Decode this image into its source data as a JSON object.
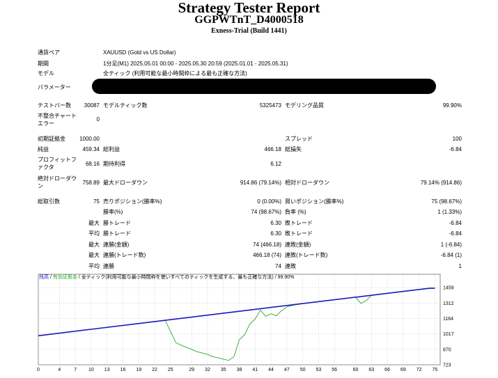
{
  "header": {
    "title": "Strategy Tester Report",
    "expert": "GGPWTnT_D4000518",
    "server": "Exness-Trial (Build 1441)"
  },
  "settings": {
    "symbol_label": "通貨ペア",
    "symbol_value": "XAUUSD (Gold vs US Dollar)",
    "period_label": "期間",
    "period_value": "1分足(M1) 2025.05.01 00:00 - 2025.05.30 20:59 (2025.01.01 - 2025.05.31)",
    "model_label": "モデル",
    "model_value": "全ティック (利用可能な最小時間枠による最も正確な方法)",
    "params_label": "パラメーター"
  },
  "stats": {
    "bars_label": "テストバー数",
    "bars_value": "30087",
    "ticks_label": "モデルティック数",
    "ticks_value": "5325473",
    "quality_label": "モデリング品質",
    "quality_value": "99.90%",
    "mismatch_label_1": "不整合チャート",
    "mismatch_label_2": "エラー",
    "mismatch_value": "0",
    "deposit_label": "初期証拠金",
    "deposit_value": "1000.00",
    "spread_label": "スプレッド",
    "spread_value": "100",
    "net_label": "純益",
    "net_value": "459.34",
    "gross_profit_label": "総利益",
    "gross_profit_value": "466.18",
    "gross_loss_label": "総損失",
    "gross_loss_value": "-6.84",
    "pf_label_1": "プロフィットフ",
    "pf_label_2": "ァクタ",
    "pf_value": "68.16",
    "expected_label": "期待利得",
    "expected_value": "6.12",
    "abs_dd_label_1": "絶対ドローダウ",
    "abs_dd_label_2": "ン",
    "abs_dd_value": "758.89",
    "max_dd_label": "最大ドローダウン",
    "max_dd_value": "914.86 (79.14%)",
    "rel_dd_label": "相対ドローダウン",
    "rel_dd_value": "79.14% (914.86)",
    "trades_label": "総取引数",
    "trades_value": "75",
    "short_label": "売りポジション(勝率%)",
    "short_value": "0 (0.00%)",
    "long_label": "買いポジション(勝率%)",
    "long_value": "75 (98.67%)",
    "win_pct_label": "勝率(%)",
    "win_pct_value": "74 (98.67%)",
    "loss_pct_label": "負率 (%)",
    "loss_pct_value": "1 (1.33%)",
    "max_word": "最大",
    "avg_word": "平均",
    "max_win_label": "勝トレード",
    "max_win_value": "6.30",
    "max_loss_label": "敗トレード",
    "max_loss_value": "-6.84",
    "avg_win_label": "勝トレード",
    "avg_win_value": "6.30",
    "avg_loss_label": "敗トレード",
    "avg_loss_value": "-6.84",
    "cons_win_money_label": "連勝(金額)",
    "cons_win_money_value": "74 (466.18)",
    "cons_loss_money_label": "連敗(金額)",
    "cons_loss_money_value": "1 (-6.84)",
    "cons_win_count_label": "連勝(トレード数)",
    "cons_win_count_value": "466.18 (74)",
    "cons_loss_count_label": "連敗(トレード数)",
    "cons_loss_count_value": "-6.84 (1)",
    "avg_cons_win_label": "連勝",
    "avg_cons_win_value": "74",
    "avg_cons_loss_label": "連敗",
    "avg_cons_loss_value": "1"
  },
  "chart_legend": {
    "balance": "残高",
    "equity": "有効証拠金",
    "description": "全ティック(利用可能な最小時間枠を使いすべてのティックを生成する、最も正確な方法)",
    "quality": "99.90%"
  },
  "chart_data": {
    "type": "line",
    "xlim": [
      0,
      76
    ],
    "ylim": [
      723,
      1520
    ],
    "x_ticks": [
      "0",
      "4",
      "7",
      "10",
      "13",
      "16",
      "19",
      "22",
      "25",
      "29",
      "32",
      "35",
      "38",
      "41",
      "44",
      "47",
      "50",
      "53",
      "56",
      "60",
      "63",
      "66",
      "69",
      "72",
      "75"
    ],
    "y_ticks": [
      "1459",
      "1312",
      "1164",
      "1017",
      "870",
      "723"
    ],
    "grid": true,
    "series": [
      {
        "color": "#1a1ab8",
        "x": [
          0,
          10,
          20,
          30,
          40,
          50,
          60,
          70,
          74,
          75
        ],
        "y": [
          1000,
          1062,
          1123,
          1184,
          1246,
          1307,
          1368,
          1429,
          1453,
          1453
        ]
      },
      {
        "color": "#2fa52f",
        "x": [
          0,
          20,
          24,
          26,
          27,
          29,
          30,
          32,
          33,
          34,
          34.5,
          35,
          36,
          37,
          38,
          39,
          40,
          41,
          42,
          43,
          44,
          45,
          46,
          47,
          48,
          50,
          60,
          61,
          62,
          63,
          64,
          70,
          74,
          75
        ],
        "y": [
          1000,
          1123,
          1147,
          935,
          910,
          870,
          848,
          822,
          800,
          790,
          782,
          777,
          765,
          800,
          960,
          1010,
          1110,
          1160,
          1245,
          1185,
          1210,
          1190,
          1240,
          1275,
          1289,
          1307,
          1368,
          1308,
          1335,
          1385,
          1393,
          1429,
          1453,
          1453
        ]
      }
    ]
  }
}
